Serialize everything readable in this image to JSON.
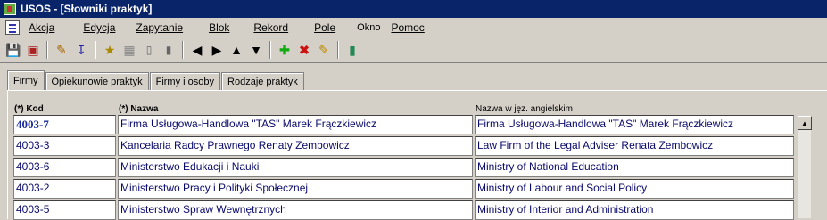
{
  "window": {
    "title": "USOS - [Słowniki praktyk]"
  },
  "menu": [
    "Akcja",
    "Edycja",
    "Zapytanie",
    "Blok",
    "Rekord",
    "Pole",
    "Okno",
    "Pomoc"
  ],
  "toolbar": {
    "icons": [
      "save-icon",
      "print-preview-icon",
      "edit-icon",
      "download-icon",
      "query-icon",
      "grid-icon",
      "bar-chart-icon",
      "bar-chart-alt-icon",
      "prev-icon",
      "next-icon",
      "up-icon",
      "down-icon",
      "add-record-icon",
      "delete-record-icon",
      "clear-icon",
      "exit-icon"
    ]
  },
  "tabs": [
    "Firmy",
    "Opiekunowie praktyk",
    "Firmy i osoby",
    "Rodzaje praktyk"
  ],
  "active_tab": "Firmy",
  "columns": {
    "kod": "(*) Kod",
    "nazwa": "(*) Nazwa",
    "nazwa_en": "Nazwa w jęz. angielskim"
  },
  "rows": [
    {
      "kod": "4003-7",
      "nazwa": "Firma Usługowa-Handlowa \"TAS\" Marek Frączkiewicz",
      "nazwa_en": "Firma Usługowa-Handlowa \"TAS\" Marek Frączkiewicz"
    },
    {
      "kod": "4003-3",
      "nazwa": "Kancelaria Radcy Prawnego Renaty Zembowicz",
      "nazwa_en": "Law Firm of the Legal Adviser Renata Zembowicz"
    },
    {
      "kod": "4003-6",
      "nazwa": "Ministerstwo Edukacji i Nauki",
      "nazwa_en": "Ministry of National Education"
    },
    {
      "kod": "4003-2",
      "nazwa": "Ministerstwo Pracy i Polityki Społecznej",
      "nazwa_en": "Ministry of Labour and Social Policy"
    },
    {
      "kod": "4003-5",
      "nazwa": "Ministerstwo Spraw Wewnętrznych",
      "nazwa_en": "Ministry of Interior and Administration"
    }
  ]
}
